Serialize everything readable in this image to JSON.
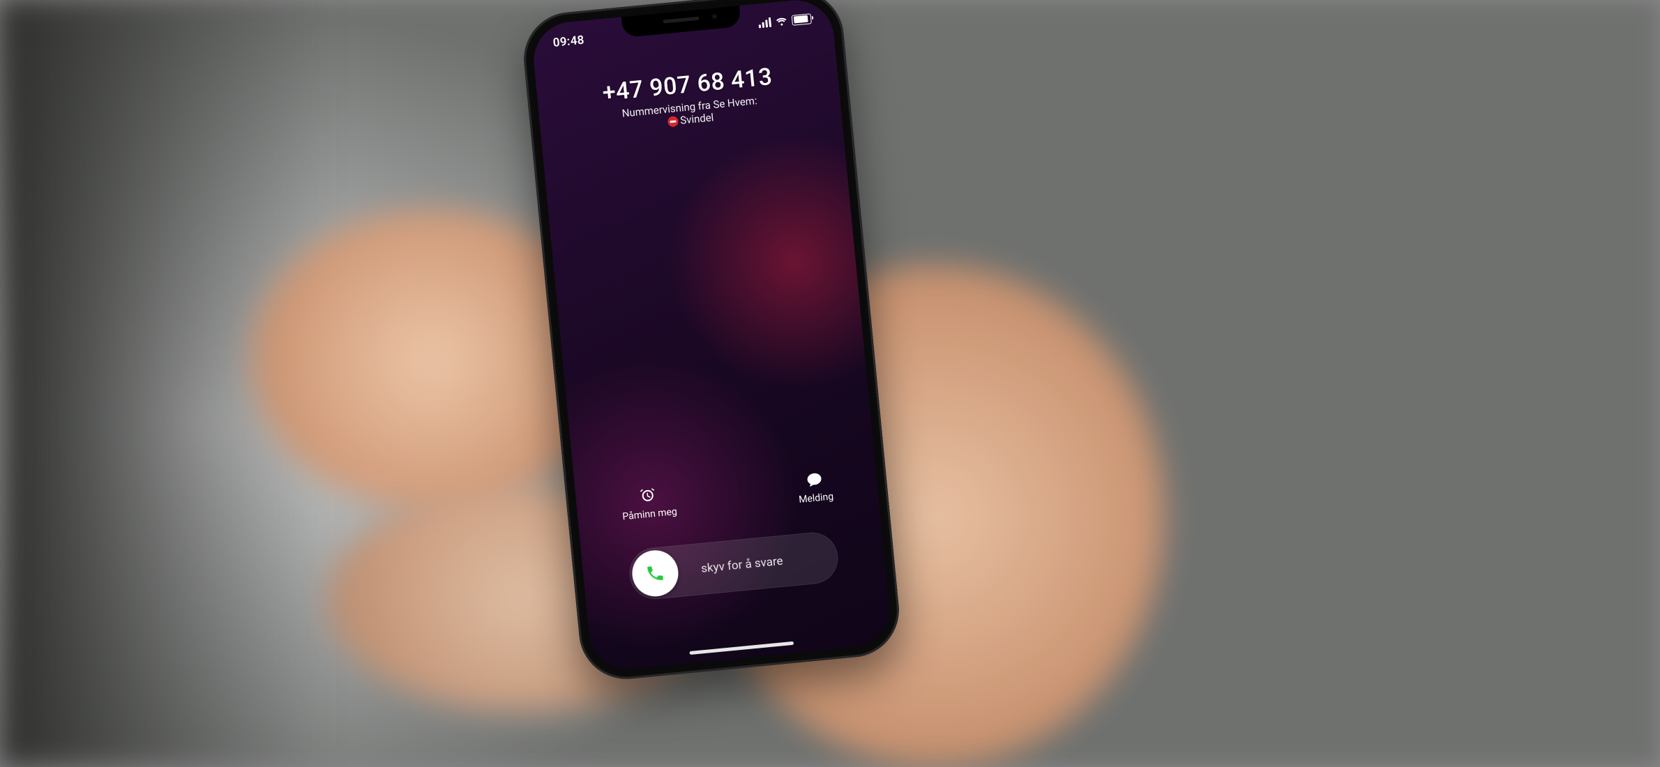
{
  "statusbar": {
    "time": "09:48"
  },
  "caller": {
    "number": "+47 907 68 413",
    "subtitle_line1": "Nummervisning fra Se Hvem:",
    "subtitle_line2": "Svindel"
  },
  "actions": {
    "remind": {
      "label": "Påminn meg"
    },
    "message": {
      "label": "Melding"
    }
  },
  "answer": {
    "slide_text": "skyv for å svare"
  }
}
